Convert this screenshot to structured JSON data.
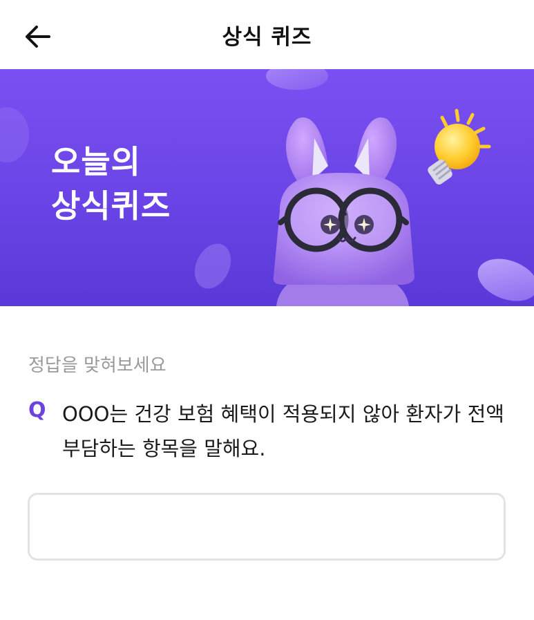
{
  "header": {
    "title": "상식 퀴즈",
    "back_icon": "arrow-left-icon"
  },
  "banner": {
    "title_line1": "오늘의",
    "title_line2": "상식퀴즈",
    "mascot": "purple-rabbit-with-glasses",
    "decoration_icon": "lightbulb-icon",
    "colors": {
      "background_top": "#7b50f2",
      "background_bottom": "#5a39d8",
      "mascot": "#b58cf5",
      "bulb": "#ffc93a"
    }
  },
  "quiz": {
    "hint": "정답을 맞혀보세요",
    "q_label": "Q",
    "question": "OOO는 건강 보험 혜택이 적용되지 않아 환자가 전액 부담하는 항목을 말해요.",
    "answer_value": "",
    "answer_placeholder": ""
  },
  "colors": {
    "accent": "#6a43e0",
    "hint_text": "#9a9a9a",
    "input_border": "#e3e3e3"
  }
}
